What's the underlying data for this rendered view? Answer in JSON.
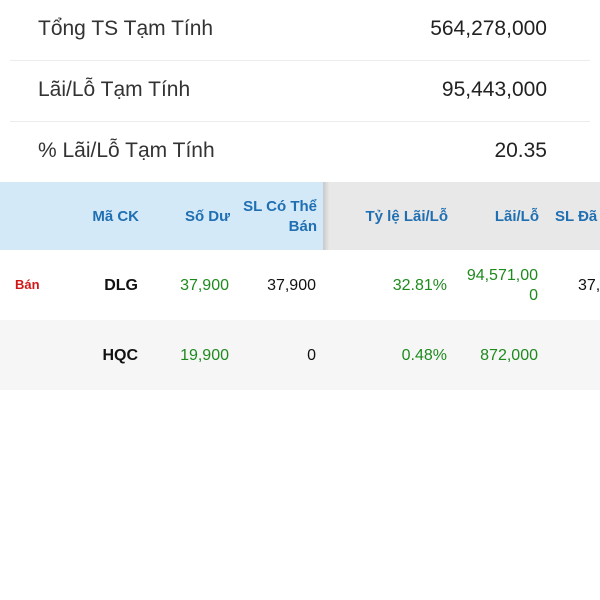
{
  "summary": [
    {
      "label": "Tổng TS Tạm Tính",
      "value": "564,278,000"
    },
    {
      "label": "Lãi/Lỗ Tạm Tính",
      "value": "95,443,000"
    },
    {
      "label": "% Lãi/Lỗ Tạm Tính",
      "value": "20.35"
    }
  ],
  "table": {
    "headers": {
      "symbol": "Mã CK",
      "balance": "Số Dư",
      "sellable_line1": "SL Có Thể",
      "sellable_line2": "Bán",
      "pl_pct": "Tỷ lệ Lãi/Lỗ",
      "pl": "Lãi/Lỗ",
      "sold_partial": "SL Đã"
    },
    "rows": [
      {
        "action": "Bán",
        "symbol": "DLG",
        "balance": "37,900",
        "sellable": "37,900",
        "pl_pct": "32.81%",
        "pl_line1": "94,571,00",
        "pl_line2": "0",
        "sold_partial": "37,"
      },
      {
        "action": "",
        "symbol": "HQC",
        "balance": "19,900",
        "sellable": "0",
        "pl_pct": "0.48%",
        "pl_line1": "872,000",
        "pl_line2": "",
        "sold_partial": ""
      }
    ]
  },
  "colors": {
    "header_left_bg": "#d3e9f7",
    "header_right_bg": "#e8e8e8",
    "header_text": "#1f6fb2",
    "positive": "#1e8a1e",
    "sell_action": "#d01818"
  }
}
